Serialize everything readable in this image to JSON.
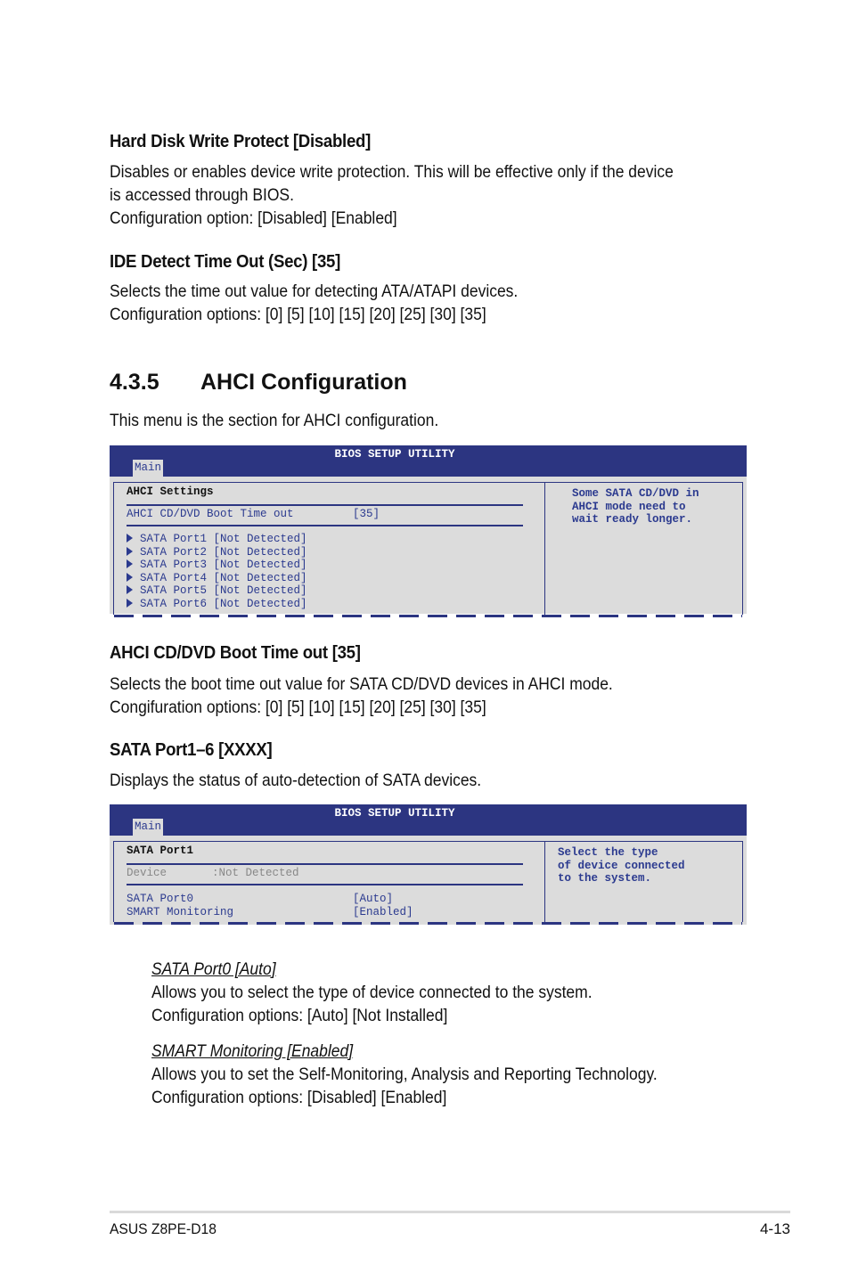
{
  "sections": {
    "hdd_write_protect": {
      "heading": "Hard Disk Write Protect [Disabled]",
      "lines": [
        "Disables or enables device write protection. This will be effective only if the device",
        "is accessed through BIOS.",
        "Configuration option: [Disabled] [Enabled]"
      ]
    },
    "ide_detect": {
      "heading": "IDE Detect Time Out (Sec) [35]",
      "lines": [
        "Selects the time out value for detecting ATA/ATAPI devices.",
        "Configuration options: [0] [5] [10] [15] [20] [25] [30] [35]"
      ]
    },
    "ahci_config": {
      "number": "4.3.5",
      "title": "AHCI Configuration",
      "intro": "This menu is the section for AHCI configuration."
    },
    "ahci_boot_timeout": {
      "heading": "AHCI CD/DVD Boot Time out [35]",
      "lines": [
        "Selects the boot time out value for SATA CD/DVD devices in AHCI mode.",
        "Congifuration options: [0] [5] [10] [15] [20] [25] [30] [35]"
      ]
    },
    "sata_ports": {
      "heading": "SATA Port1–6 [XXXX]",
      "intro": "Displays the status of auto-detection of SATA devices."
    },
    "sata_port0": {
      "heading": "SATA Port0 [Auto]",
      "lines": [
        "Allows you to select the type of device connected to the system.",
        "Configuration options: [Auto] [Not Installed]"
      ]
    },
    "smart_monitoring": {
      "heading": "SMART Monitoring [Enabled]",
      "lines": [
        "Allows you to set the Self-Monitoring, Analysis and Reporting Technology.",
        "Configuration options: [Disabled] [Enabled]"
      ]
    }
  },
  "bios1": {
    "title": "BIOS SETUP UTILITY",
    "tab": "Main",
    "heading": "AHCI Settings",
    "boot_timeout": {
      "label": "AHCI CD/DVD Boot Time out",
      "value": "[35]"
    },
    "ports": [
      {
        "label": "SATA Port1",
        "value": "[Not Detected]"
      },
      {
        "label": "SATA Port2",
        "value": "[Not Detected]"
      },
      {
        "label": "SATA Port3",
        "value": "[Not Detected]"
      },
      {
        "label": "SATA Port4",
        "value": "[Not Detected]"
      },
      {
        "label": "SATA Port5",
        "value": "[Not Detected]"
      },
      {
        "label": "SATA Port6",
        "value": "[Not Detected]"
      }
    ],
    "help": [
      "Some SATA CD/DVD in",
      "AHCI mode need to",
      "wait ready longer."
    ]
  },
  "bios2": {
    "title": "BIOS SETUP UTILITY",
    "tab": "Main",
    "heading": "SATA Port1",
    "device": {
      "label": "Device",
      "value": ":Not Detected"
    },
    "items": [
      {
        "label": "SATA Port0",
        "value": "[Auto]"
      },
      {
        "label": "SMART Monitoring",
        "value": "[Enabled]"
      }
    ],
    "help": [
      "Select the type",
      "of device connected",
      "to the system."
    ]
  },
  "footer": {
    "product": "ASUS Z8PE-D18",
    "page": "4-13"
  },
  "colors": {
    "bios_blue": "#2c3581",
    "bios_text": "#2b3a8f",
    "bios_bg": "#dcdcdc"
  }
}
